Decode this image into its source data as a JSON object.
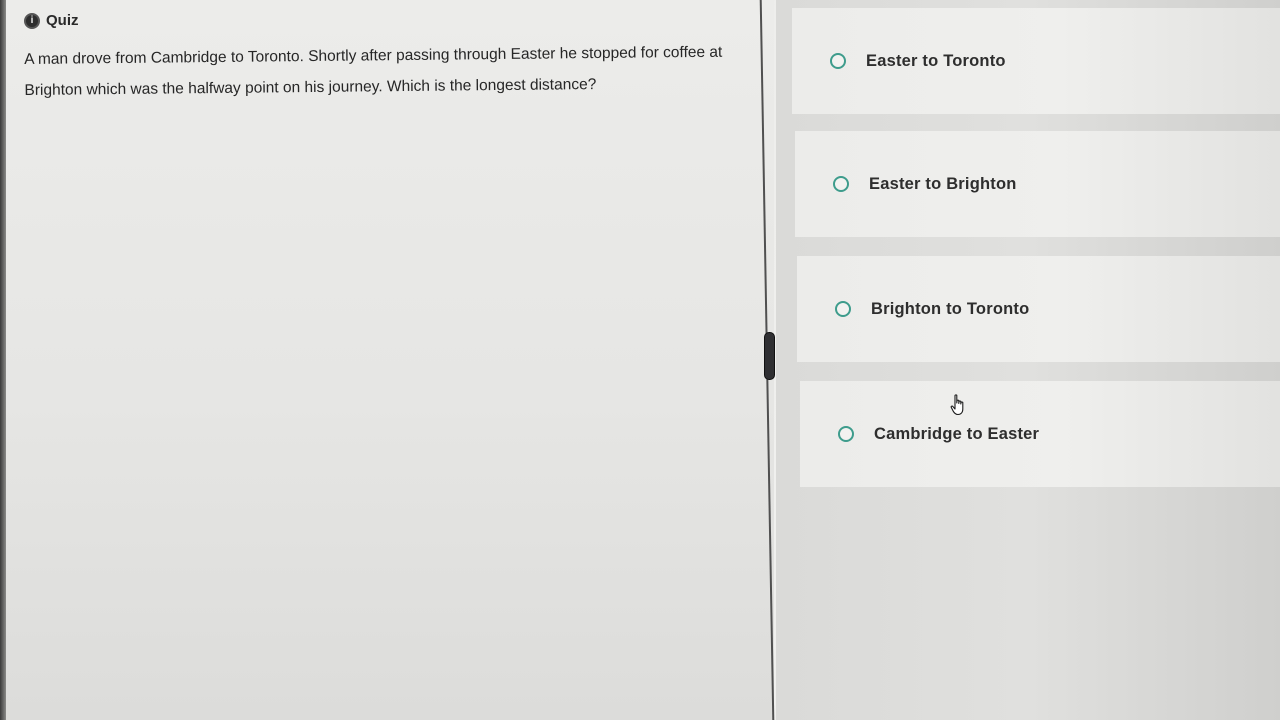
{
  "header": {
    "icon": "info-icon",
    "icon_glyph": "i",
    "title": "Quiz"
  },
  "question": {
    "text": "A man drove from Cambridge to Toronto. Shortly after passing through Easter he stopped for coffee at Brighton which was the halfway point on his journey. Which is the longest distance?"
  },
  "options": [
    {
      "label": "Easter to Toronto",
      "selected": false
    },
    {
      "label": "Easter to Brighton",
      "selected": false
    },
    {
      "label": "Brighton to Toronto",
      "selected": false
    },
    {
      "label": "Cambridge to Easter",
      "selected": false
    }
  ],
  "colors": {
    "radio_border": "#3e9c8c",
    "text": "#2e2e2e"
  }
}
